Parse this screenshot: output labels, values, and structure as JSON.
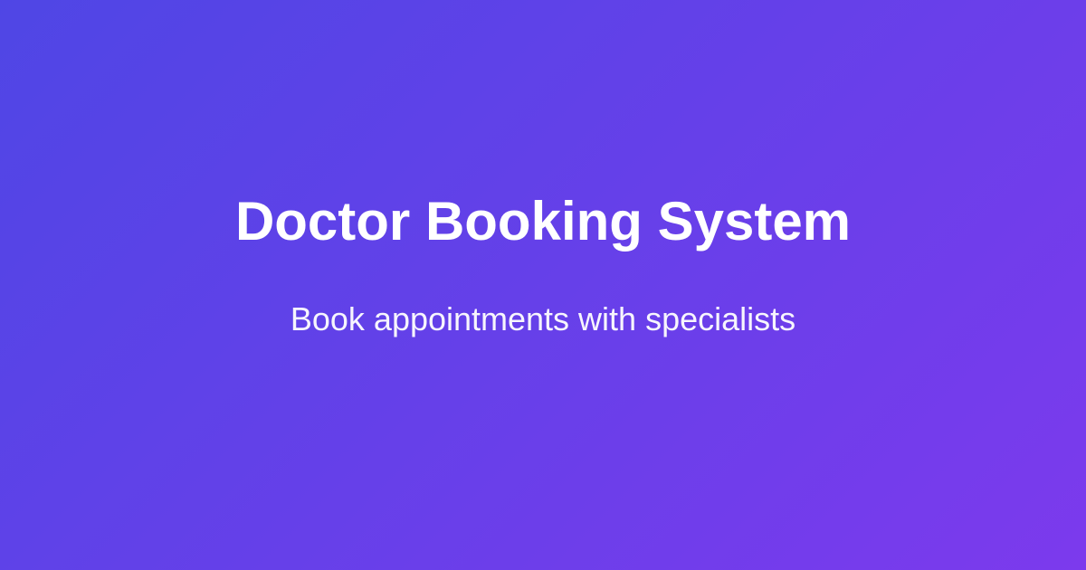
{
  "banner": {
    "title": "Doctor Booking System",
    "subtitle": "Book appointments with specialists"
  },
  "colors": {
    "gradient_start": "#4f46e5",
    "gradient_end": "#7c3aed",
    "text": "#ffffff"
  }
}
